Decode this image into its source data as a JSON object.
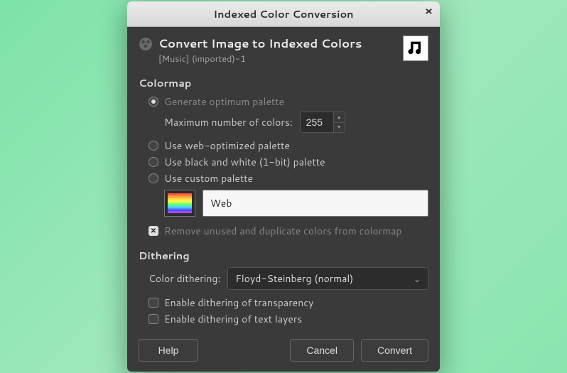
{
  "titlebar": {
    "title": "Indexed Color Conversion"
  },
  "header": {
    "title": "Convert Image to Indexed Colors",
    "subtitle": "[Music] (imported)-1"
  },
  "colormap": {
    "section_title": "Colormap",
    "opt_generate": "Generate optimum palette",
    "max_colors_label": "Maximum number of colors:",
    "max_colors_value": "255",
    "opt_web": "Use web-optimized palette",
    "opt_bw": "Use black and white (1-bit) palette",
    "opt_custom": "Use custom palette",
    "palette_name": "Web",
    "remove_dups": "Remove unused and duplicate colors from colormap"
  },
  "dithering": {
    "section_title": "Dithering",
    "label": "Color dithering:",
    "value": "Floyd-Steinberg (normal)",
    "opt_trans": "Enable dithering of transparency",
    "opt_text": "Enable dithering of text layers"
  },
  "buttons": {
    "help": "Help",
    "cancel": "Cancel",
    "convert": "Convert"
  }
}
